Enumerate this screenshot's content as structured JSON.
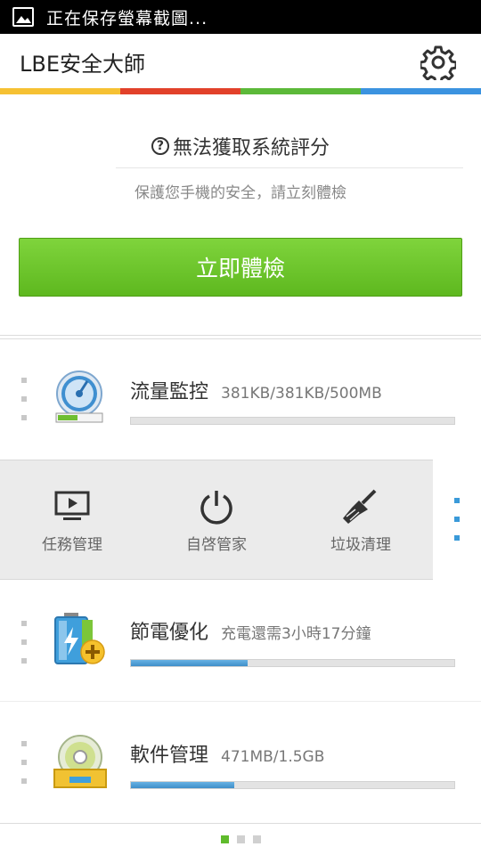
{
  "status_bar": {
    "text": "正在保存螢幕截圖..."
  },
  "header": {
    "title": "LBE安全大師"
  },
  "color_strip": [
    "#f6c133",
    "#e2412a",
    "#5cb939",
    "#3b93e0"
  ],
  "score": {
    "title": "無法獲取系統評分",
    "subtitle": "保護您手機的安全，請立刻體檢",
    "button": "立即體檢"
  },
  "cards": {
    "traffic": {
      "title": "流量監控",
      "detail": "381KB/381KB/500MB",
      "progress": 0
    },
    "battery": {
      "title": "節電優化",
      "detail": "充電還需3小時17分鐘",
      "progress": 0.36
    },
    "software": {
      "title": "軟件管理",
      "detail": "471MB/1.5GB",
      "progress": 0.32
    }
  },
  "tools": [
    {
      "label": "任務管理",
      "icon": "task-manager-icon"
    },
    {
      "label": "自啓管家",
      "icon": "power-icon"
    },
    {
      "label": "垃圾清理",
      "icon": "broom-icon"
    }
  ],
  "pager": {
    "pages": 3,
    "active": 0
  }
}
